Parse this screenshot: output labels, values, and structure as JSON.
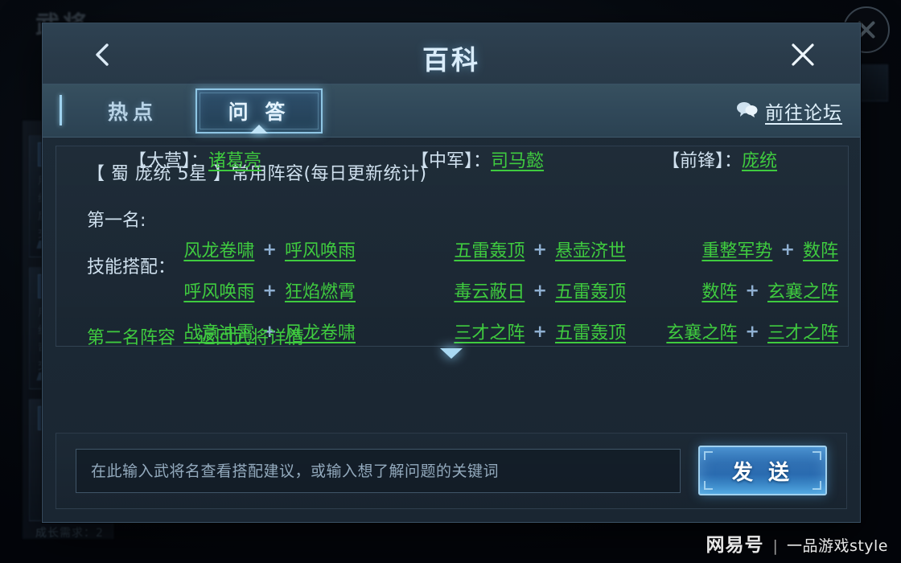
{
  "background": {
    "page_title": "武将",
    "footer_note": "成长需求：2",
    "card_lines": "用\n统\n后\n交",
    "close_icon": "circle-close-icon"
  },
  "modal": {
    "title": "百科",
    "back_icon": "chevron-left-icon",
    "close_icon": "close-icon",
    "tabs": [
      {
        "label": "热点",
        "active": false
      },
      {
        "label": "问 答",
        "active": true
      }
    ],
    "forum": {
      "icon": "speech-bubble-icon",
      "label": "前往论坛"
    }
  },
  "content": {
    "heading": "【 蜀 庞统 5星 】常用阵容(每日更新统计)",
    "rank_label": "第一名:",
    "skills_label": "技能搭配：",
    "columns": [
      {
        "slot_label": "【大营】：",
        "hero": "诸葛亮",
        "pairs": [
          {
            "left": "风龙卷啸",
            "op": "+",
            "right": "呼风唤雨"
          },
          {
            "left": "呼风唤雨",
            "op": "+",
            "right": "狂焰燃霄"
          },
          {
            "left": "战意冲霄",
            "op": "+",
            "right": "风龙卷啸"
          }
        ]
      },
      {
        "slot_label": "【中军】：",
        "hero": "司马懿",
        "pairs": [
          {
            "left": "五雷轰顶",
            "op": "+",
            "right": "悬壶济世"
          },
          {
            "left": "毒云蔽日",
            "op": "+",
            "right": "五雷轰顶"
          },
          {
            "left": "三才之阵",
            "op": "+",
            "right": "五雷轰顶"
          }
        ]
      },
      {
        "slot_label": "【前锋】：",
        "hero": "庞统",
        "pairs": [
          {
            "left": "重整军势",
            "op": "+",
            "right": "数阵"
          },
          {
            "left": "数阵",
            "op": "+",
            "right": "玄襄之阵"
          },
          {
            "left": "玄襄之阵",
            "op": "+",
            "right": "三才之阵"
          }
        ]
      }
    ],
    "clipped_links": [
      "第二名阵容",
      "返回武将详情"
    ],
    "scroll_icon": "chevron-down-icon"
  },
  "bottom": {
    "search_placeholder": "在此输入武将名查看搭配建议，或输入想了解问题的关键词",
    "search_value": "",
    "send_label": "发 送"
  },
  "watermark": {
    "logo": "网易号",
    "separator": "|",
    "name": "一品游戏style"
  },
  "colors": {
    "green_link": "#3fcb3f",
    "accent_blue": "#9fd0ef",
    "panel_bg": "#1d2a36",
    "title_text": "#d9ecfa"
  }
}
